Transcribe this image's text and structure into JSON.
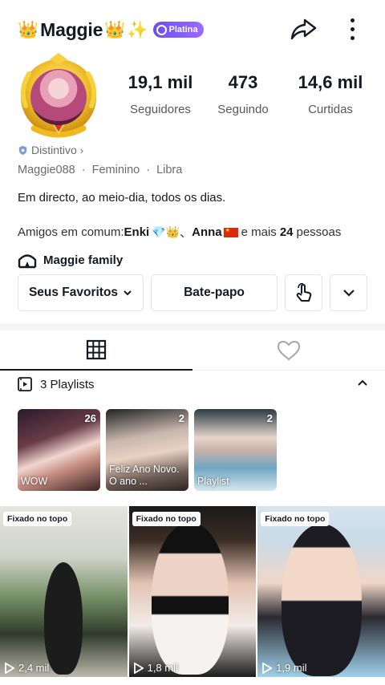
{
  "header": {
    "crown_left": "👑",
    "username": "Maggie",
    "crown_right": "👑",
    "sparkle": "✨",
    "platina_label": "Platina",
    "icons": [
      "share-icon",
      "more-icon"
    ]
  },
  "stats": [
    {
      "value": "19,1 mil",
      "label": "Seguidores"
    },
    {
      "value": "473",
      "label": "Seguindo"
    },
    {
      "value": "14,6 mil",
      "label": "Curtidas"
    }
  ],
  "profile": {
    "badge_label": "Distintivo",
    "handle": "Maggie088",
    "gender": "Feminino",
    "sign": "Libra",
    "separator": "·",
    "bio": "Em directo, ao meio-dia, todos os dias."
  },
  "friends": {
    "prefix": "Amigos em comum:",
    "friend1": "Enki",
    "friend1_emoji": "💎👑",
    "sep": "、",
    "friend2": "Anna",
    "and_more": "e mais",
    "count": "24",
    "suffix": "pessoas"
  },
  "family": {
    "label": "Maggie family"
  },
  "actions": {
    "favorites": "Seus Favoritos",
    "chat": "Bate-papo"
  },
  "tabs": [
    "videos-grid-icon",
    "liked-heart-icon"
  ],
  "playlists": {
    "heading": "3 Playlists",
    "items": [
      {
        "count": "26",
        "caption": "WOW"
      },
      {
        "count": "2",
        "caption": "Feliz Ano Novo. O ano ..."
      },
      {
        "count": "2",
        "caption": "Playlist"
      }
    ]
  },
  "videos": [
    {
      "pinned": "Fixado no topo",
      "views": "2,4 mil"
    },
    {
      "pinned": "Fixado no topo",
      "views": "1,8 mil"
    },
    {
      "pinned": "Fixado no topo",
      "views": "1,9 mil"
    }
  ],
  "colors": {
    "platina": "#7b5cf6",
    "text": "#161823",
    "muted": "#6a6b70"
  }
}
